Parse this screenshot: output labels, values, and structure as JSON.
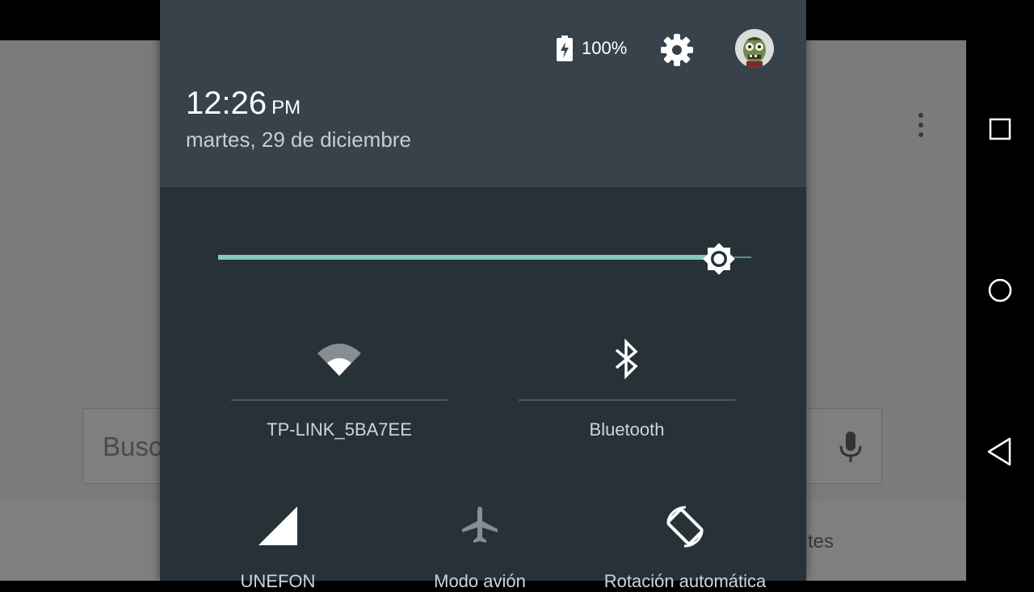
{
  "background_app": {
    "search_placeholder": "Busc",
    "tab_text": "tes",
    "icons": [
      "overflow-menu-icon",
      "microphone-icon"
    ]
  },
  "status_header": {
    "battery_percent": "100%",
    "battery_icon": "battery-charging-icon",
    "settings_icon": "gear-icon",
    "avatar": "user-avatar-zombie",
    "time": "12:26",
    "ampm": "PM",
    "date": "martes, 29 de diciembre"
  },
  "brightness": {
    "level": 0.94,
    "accent_color": "#80cbc4"
  },
  "tiles": {
    "wifi": {
      "label": "TP-LINK_5BA7EE",
      "icon": "wifi-icon"
    },
    "bluetooth": {
      "label": "Bluetooth",
      "icon": "bluetooth-icon"
    },
    "cellular": {
      "label": "UNEFON",
      "icon": "cellular-signal-icon"
    },
    "airplane": {
      "label": "Modo avión",
      "icon": "airplane-icon"
    },
    "rotation": {
      "label": "Rotación automática",
      "icon": "auto-rotate-icon"
    }
  },
  "navbar": {
    "buttons": [
      "recents-button",
      "home-button",
      "back-button"
    ]
  },
  "colors": {
    "shade_bg": "#263238",
    "header_bg": "#37424a"
  }
}
